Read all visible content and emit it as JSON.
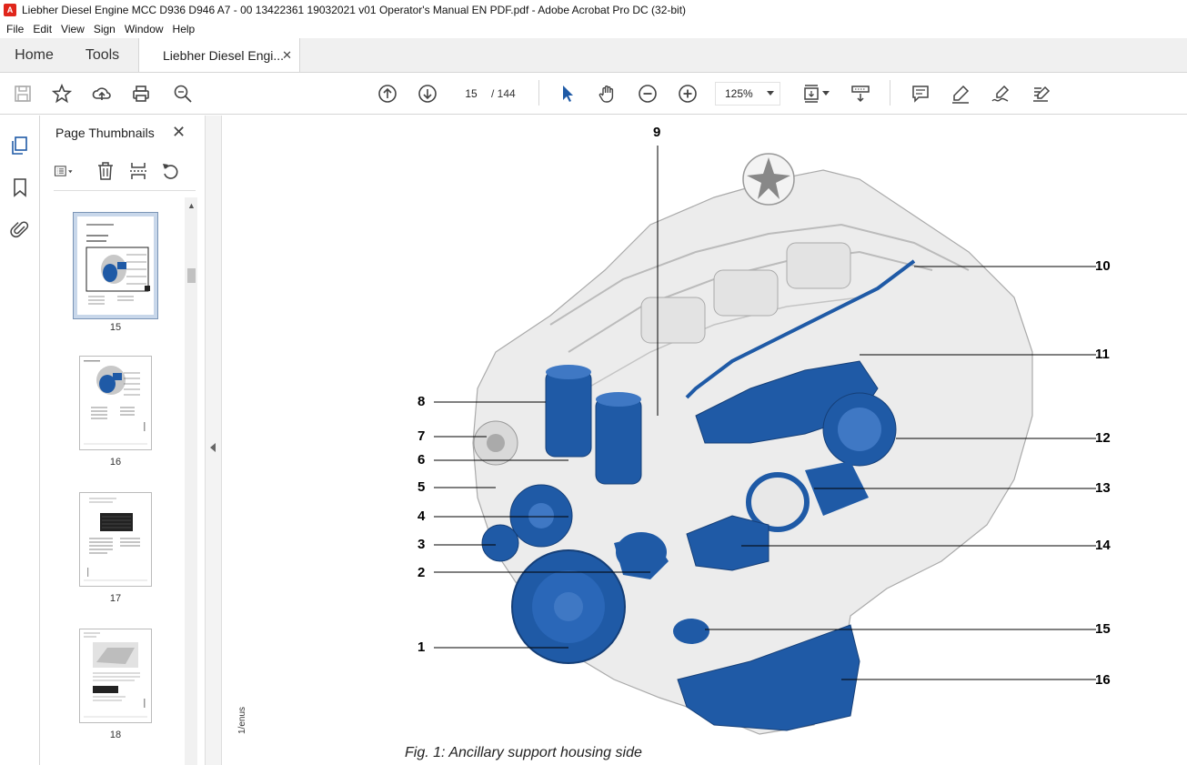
{
  "window": {
    "title": "Liebher Diesel Engine MCC D936 D946 A7 - 00 13422361 19032021 v01 Operator's Manual EN PDF.pdf - Adobe Acrobat Pro DC (32-bit)"
  },
  "menu": [
    "File",
    "Edit",
    "View",
    "Sign",
    "Window",
    "Help"
  ],
  "tabs": {
    "home": "Home",
    "tools": "Tools",
    "document": "Liebher Diesel Engi...",
    "close": "✕"
  },
  "toolbar": {
    "current_page": "15",
    "page_total": "/ 144",
    "zoom": "125%"
  },
  "thumbnails": {
    "title": "Page Thumbnails",
    "close": "✕",
    "pages": [
      {
        "label": "15",
        "selected": true
      },
      {
        "label": "16",
        "selected": false
      },
      {
        "label": "17",
        "selected": false
      },
      {
        "label": "18",
        "selected": false
      }
    ]
  },
  "document": {
    "callouts": [
      "1",
      "2",
      "3",
      "4",
      "5",
      "6",
      "7",
      "8",
      "9",
      "10",
      "11",
      "12",
      "13",
      "14",
      "15",
      "16"
    ],
    "caption": "Fig. 1: Ancillary support housing side",
    "side_note": "1/enus"
  },
  "colors": {
    "accent_blue": "#1f5aa6",
    "engine_gray": "#e6e6e6"
  }
}
